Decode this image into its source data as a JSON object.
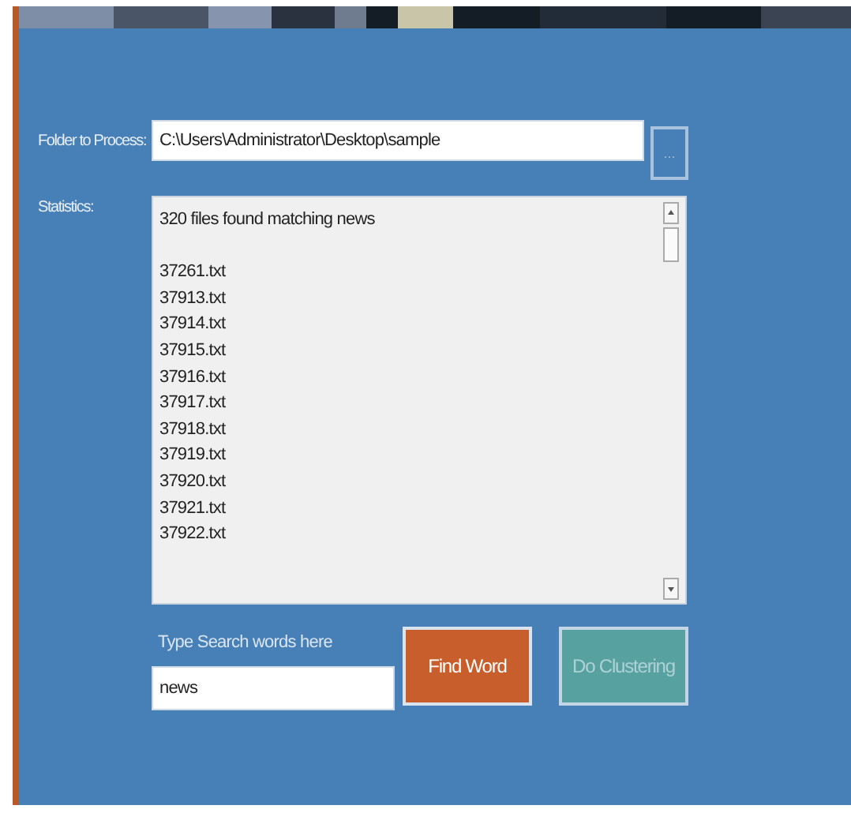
{
  "folder": {
    "label": "Folder to Process:",
    "value": "C:\\Users\\Administrator\\Desktop\\sample",
    "browse_button": "..."
  },
  "statistics": {
    "label": "Statistics:",
    "summary": "320 files found matching news",
    "files": [
      "37261.txt",
      "37913.txt",
      "37914.txt",
      "37915.txt",
      "37916.txt",
      "37917.txt",
      "37918.txt",
      "37919.txt",
      "37920.txt",
      "37921.txt",
      "37922.txt"
    ]
  },
  "search": {
    "label": "Type Search words here",
    "value": "news"
  },
  "buttons": [
    {
      "label": "Find Word",
      "kind": "find",
      "disabled": false
    },
    {
      "label": "Do Clustering",
      "kind": "cluster",
      "disabled": true
    }
  ]
}
